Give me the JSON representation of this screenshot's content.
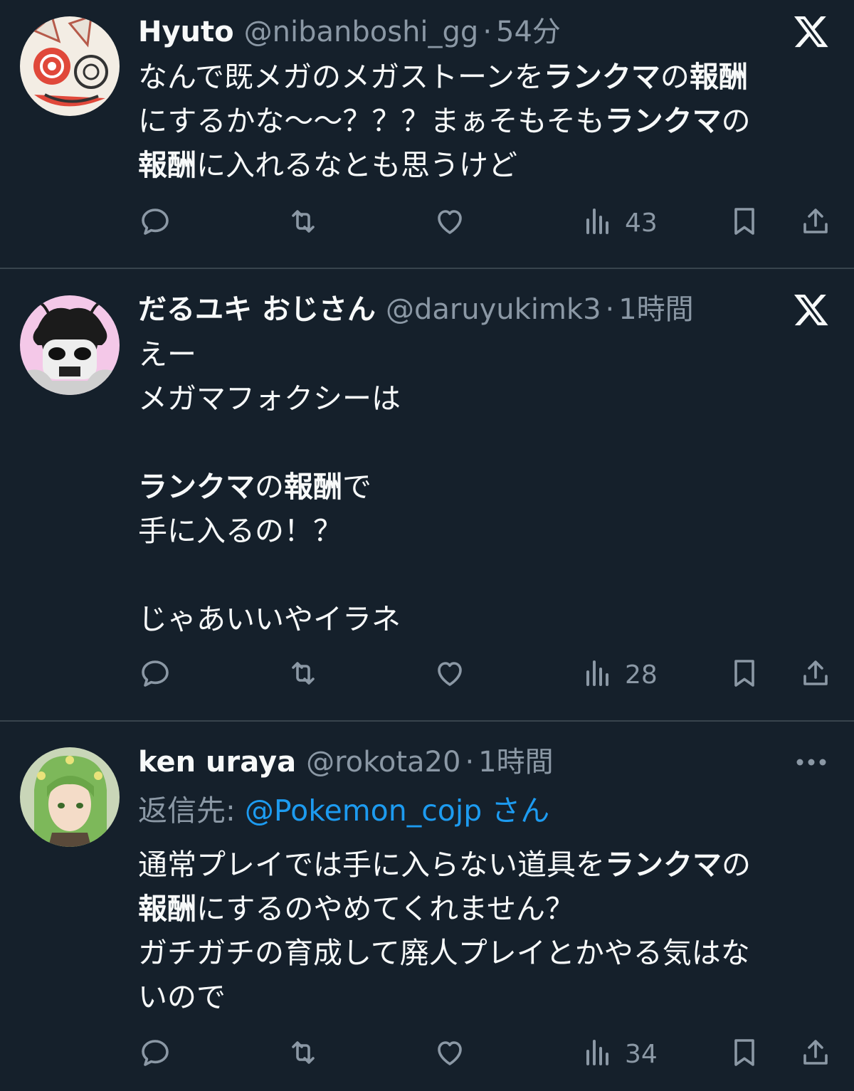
{
  "colors": {
    "background": "#15202b",
    "text": "#f7f9f9",
    "secondary": "#8b98a5",
    "link": "#1d9bf0",
    "divider": "#38444d"
  },
  "separator": "·",
  "tweets": [
    {
      "name": "Hyuto",
      "handle": "@nibanboshi_gg",
      "time": "54分",
      "corner_icon": "x-logo-icon",
      "lines": [
        [
          {
            "t": "なんで既メガのメガストーンを"
          },
          {
            "t": "ランクマ",
            "b": true
          },
          {
            "t": "の"
          },
          {
            "t": "報酬",
            "b": true
          }
        ],
        [
          {
            "t": "にするかな〜〜？？？まぁそもそも"
          },
          {
            "t": "ランクマ",
            "b": true
          },
          {
            "t": "の"
          }
        ],
        [
          {
            "t": "報酬",
            "b": true
          },
          {
            "t": "に入れるなとも思うけど"
          }
        ]
      ],
      "views": "43"
    },
    {
      "name": "だるユキ おじさん",
      "handle": "@daruyukimk3",
      "time": "1時間",
      "corner_icon": "x-logo-icon",
      "lines": [
        [
          {
            "t": "えー"
          }
        ],
        [
          {
            "t": "メガマフォクシーは"
          }
        ],
        [],
        [
          {
            "t": "ランクマ",
            "b": true
          },
          {
            "t": "の"
          },
          {
            "t": "報酬",
            "b": true
          },
          {
            "t": "で"
          }
        ],
        [
          {
            "t": "手に入るの！？"
          }
        ],
        [],
        [
          {
            "t": "じゃあいいやイラネ"
          }
        ]
      ],
      "views": "28"
    },
    {
      "name": "ken uraya",
      "handle": "@rokota20",
      "time": "1時間",
      "corner_icon": "more-dots-icon",
      "reply_prefix": "返信先: ",
      "reply_to": "@Pokemon_cojp さん",
      "lines": [
        [
          {
            "t": "通常プレイでは手に入らない道具を"
          },
          {
            "t": "ランクマ",
            "b": true
          },
          {
            "t": "の"
          }
        ],
        [
          {
            "t": "報酬",
            "b": true
          },
          {
            "t": "にするのやめてくれません？"
          }
        ],
        [
          {
            "t": "ガチガチの育成して廃人プレイとかやる気はな"
          }
        ],
        [
          {
            "t": "いので"
          }
        ]
      ],
      "views": "34"
    }
  ],
  "action_icons": [
    "reply-icon",
    "retweet-icon",
    "like-icon",
    "views-icon",
    "bookmark-icon",
    "share-icon"
  ]
}
